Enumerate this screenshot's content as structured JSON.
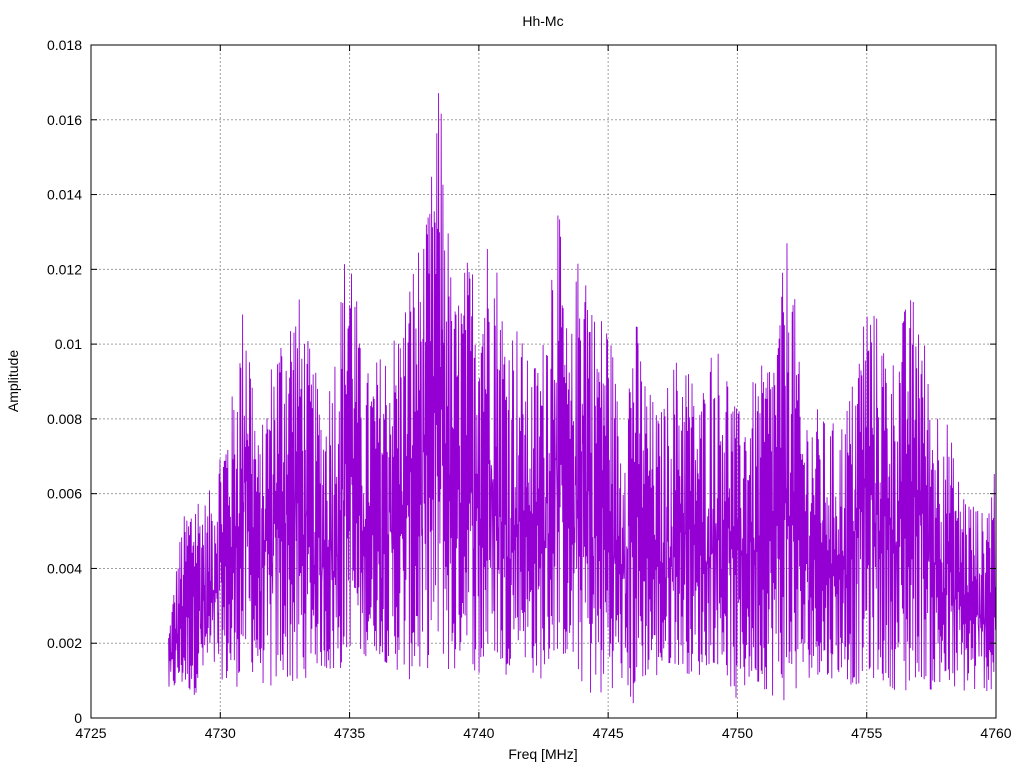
{
  "chart_data": {
    "type": "line",
    "title": "Hh-Mc",
    "xlabel": "Freq [MHz]",
    "ylabel": "Amplitude",
    "xlim": [
      4725,
      4760
    ],
    "ylim": [
      0,
      0.018
    ],
    "x_ticks": [
      "4725",
      "4730",
      "4735",
      "4740",
      "4745",
      "4750",
      "4755",
      "4760"
    ],
    "y_ticks": [
      "0",
      "0.002",
      "0.004",
      "0.006",
      "0.008",
      "0.01",
      "0.012",
      "0.014",
      "0.016",
      "0.018"
    ],
    "grid": true,
    "legend": "none",
    "line_color": "#9400d3",
    "series": [
      {
        "x": [
          4728.0,
          4728.5,
          4729.0,
          4729.5,
          4730.0,
          4730.5,
          4731.0,
          4731.5,
          4732.0,
          4732.5,
          4733.0,
          4733.5,
          4734.0,
          4734.5,
          4735.0,
          4735.5,
          4736.0,
          4736.5,
          4737.0,
          4737.5,
          4738.0,
          4738.5,
          4739.0,
          4739.5,
          4740.0,
          4740.5,
          4741.0,
          4741.5,
          4742.0,
          4742.5,
          4743.0,
          4743.5,
          4744.0,
          4744.5,
          4745.0,
          4745.5,
          4746.0,
          4746.5,
          4747.0,
          4747.5,
          4748.0,
          4748.5,
          4749.0,
          4749.5,
          4750.0,
          4750.5,
          4751.0,
          4751.5,
          4752.0,
          4752.5,
          4753.0,
          4753.5,
          4754.0,
          4754.5,
          4755.0,
          4755.5,
          4756.0,
          4756.5,
          4757.0,
          4757.5,
          4758.0,
          4758.5,
          4759.0,
          4759.5,
          4760.0
        ],
        "envelope_max": [
          0.0025,
          0.0052,
          0.0064,
          0.0058,
          0.0076,
          0.0088,
          0.012,
          0.0072,
          0.0098,
          0.011,
          0.0115,
          0.0098,
          0.0084,
          0.0104,
          0.0139,
          0.0092,
          0.0096,
          0.0102,
          0.0108,
          0.0125,
          0.0133,
          0.0173,
          0.011,
          0.0123,
          0.0125,
          0.0135,
          0.0108,
          0.0107,
          0.0093,
          0.0103,
          0.0146,
          0.0096,
          0.0139,
          0.0108,
          0.0111,
          0.0078,
          0.0111,
          0.009,
          0.0081,
          0.0096,
          0.01,
          0.0084,
          0.0101,
          0.0099,
          0.0082,
          0.0089,
          0.0095,
          0.0104,
          0.0135,
          0.0084,
          0.0084,
          0.0079,
          0.008,
          0.0092,
          0.0116,
          0.0106,
          0.0097,
          0.0111,
          0.0116,
          0.0086,
          0.0085,
          0.0066,
          0.006,
          0.0055,
          0.0072
        ],
        "envelope_min": [
          0.0007,
          0.0008,
          0.0006,
          0.0012,
          0.0011,
          0.0006,
          0.0014,
          0.001,
          0.0007,
          0.0012,
          0.0004,
          0.0015,
          0.0013,
          0.001,
          0.0019,
          0.0016,
          0.0018,
          0.0014,
          0.0012,
          0.0009,
          0.0013,
          0.0018,
          0.0009,
          0.0023,
          0.0007,
          0.0019,
          0.001,
          0.0021,
          0.0012,
          0.001,
          0.0018,
          0.0015,
          0.0009,
          0.0004,
          0.0007,
          0.001,
          0.0002,
          0.0012,
          0.001,
          0.0015,
          0.0012,
          0.0011,
          0.0015,
          0.0013,
          0.0003,
          0.001,
          0.0008,
          0.0005,
          0.0004,
          0.0009,
          0.0012,
          0.001,
          0.0012,
          0.0008,
          0.0011,
          0.001,
          0.0008,
          0.0005,
          0.0012,
          0.0007,
          0.0005,
          0.0008,
          0.0006,
          0.0008,
          0.0005
        ]
      }
    ]
  }
}
